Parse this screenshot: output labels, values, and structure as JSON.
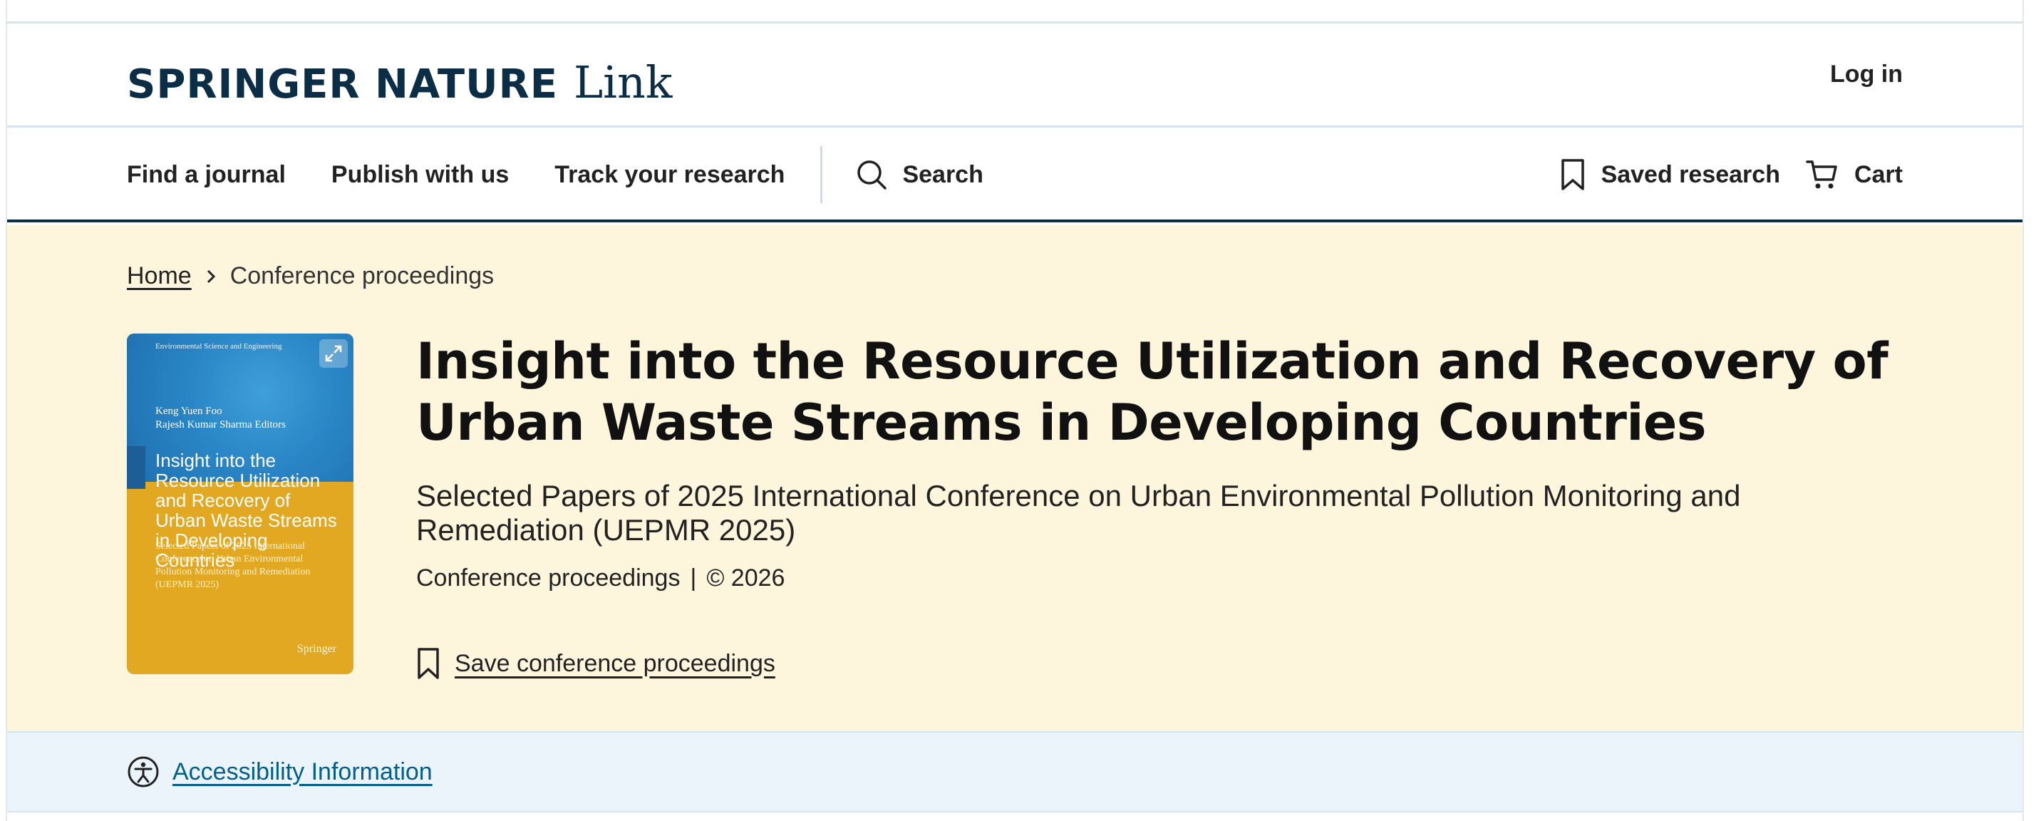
{
  "header": {
    "logo_main": "SPRINGER NATURE",
    "logo_sub": "Link",
    "login_label": "Log in"
  },
  "nav": {
    "items": [
      {
        "label": "Find a journal"
      },
      {
        "label": "Publish with us"
      },
      {
        "label": "Track your research"
      }
    ],
    "search_label": "Search",
    "saved_label": "Saved research",
    "cart_label": "Cart"
  },
  "breadcrumb": {
    "home": "Home",
    "current": "Conference proceedings"
  },
  "cover": {
    "series": "Environmental Science and Engineering",
    "authors": [
      "Keng Yuen Foo",
      "Rajesh Kumar Sharma  Editors"
    ],
    "title": "Insight into the Resource Utilization and Recovery of Urban Waste Streams in Developing Countries",
    "subtitle": "Selected Papers of 2025 International Conference on Urban Environmental Pollution Monitoring and Remediation (UEPMR 2025)",
    "publisher": "Springer"
  },
  "book": {
    "title": "Insight into the Resource Utilization and Recovery of Urban Waste Streams in Developing Countries",
    "subtitle": "Selected Papers of 2025 International Conference on Urban Environmental Pollution Monitoring and Remediation (UEPMR 2025)",
    "type": "Conference proceedings",
    "separator": "|",
    "copyright": "© 2026",
    "save_label": "Save conference proceedings"
  },
  "accessibility": {
    "label": "Accessibility Information"
  },
  "colors": {
    "brand_navy": "#0b2d45",
    "hero_bg": "#fdf5dc",
    "link_blue": "#025e8d",
    "a11y_bg": "#ecf4fb"
  },
  "icons": {
    "search": "search-icon",
    "saved": "bookmark-icon",
    "cart": "cart-icon",
    "chevron": "chevron-right-icon",
    "expand": "expand-icon",
    "accessibility": "accessibility-icon"
  }
}
